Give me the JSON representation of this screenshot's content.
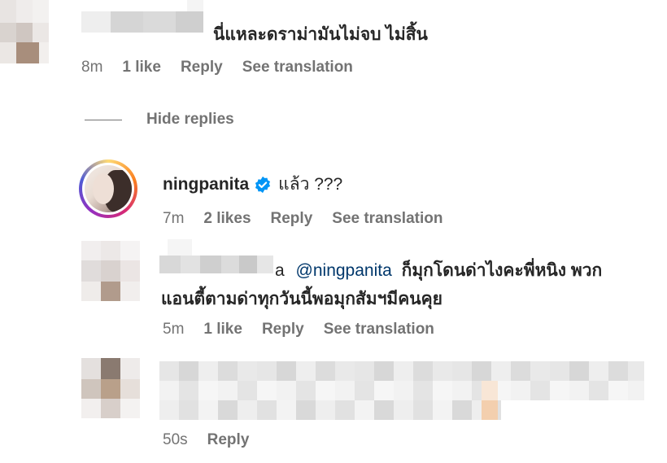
{
  "comment1": {
    "text": "นี่แหละดราม่ามันไม่จบ ไม่สิ้น",
    "time": "8m",
    "likes": "1 like",
    "reply": "Reply",
    "translate": "See translation"
  },
  "hide_replies": "Hide replies",
  "reply1": {
    "username": "ningpanita",
    "text": "แล้ว ???",
    "time": "7m",
    "likes": "2 likes",
    "reply": "Reply",
    "translate": "See translation"
  },
  "reply2": {
    "prefix": "a",
    "mention": "@ningpanita",
    "line1": "ก็มุกโดนด่าไงคะพี่หนิง พวก",
    "line2": "แอนตี้ตามด่าทุกวันนี้พอมุกสัมฯมีคนคุย",
    "time": "5m",
    "likes": "1 like",
    "reply": "Reply",
    "translate": "See translation"
  },
  "reply3": {
    "time": "50s",
    "reply": "Reply"
  },
  "colors": {
    "mention": "#00376b",
    "meta": "#737373",
    "verified": "#0095f6"
  }
}
